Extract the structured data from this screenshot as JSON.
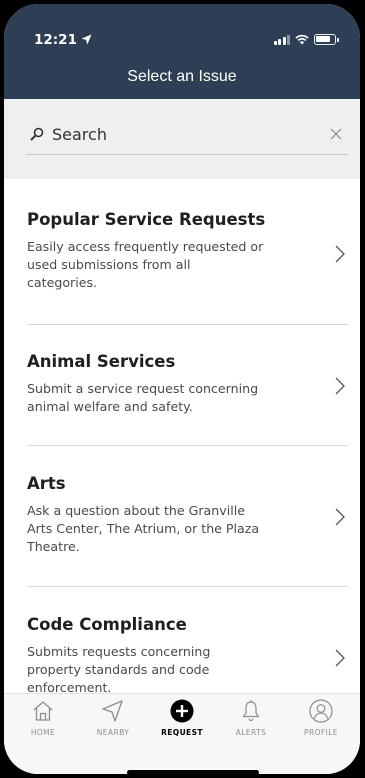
{
  "status_bar": {
    "time": "12:21"
  },
  "header": {
    "title": "Select an Issue"
  },
  "search": {
    "placeholder": "Search"
  },
  "categories": [
    {
      "title": "Popular Service Requests",
      "desc_lines": [
        "Easily access frequently requested or",
        "used submissions from all",
        "categories."
      ]
    },
    {
      "title": "Animal Services",
      "desc_lines": [
        "Submit a service request concerning",
        "animal welfare and safety."
      ]
    },
    {
      "title": "Arts",
      "desc_lines": [
        "Ask a question about the Granville",
        "Arts Center, The Atrium, or the Plaza",
        "Theatre."
      ]
    },
    {
      "title": "Code Compliance",
      "desc_lines": [
        "Submits requests concerning",
        "property standards and code",
        "enforcement."
      ]
    }
  ],
  "tabs": [
    {
      "label": "HOME",
      "icon": "home-icon"
    },
    {
      "label": "NEARBY",
      "icon": "navigation-arrow-icon"
    },
    {
      "label": "REQUEST",
      "icon": "plus-circle-icon",
      "active": true
    },
    {
      "label": "ALERTS",
      "icon": "bell-icon"
    },
    {
      "label": "PROFILE",
      "icon": "user-circle-icon"
    }
  ],
  "colors": {
    "header_bg": "#2e3f55",
    "search_bg": "#efefef",
    "tab_bg": "#f7f7f7"
  }
}
